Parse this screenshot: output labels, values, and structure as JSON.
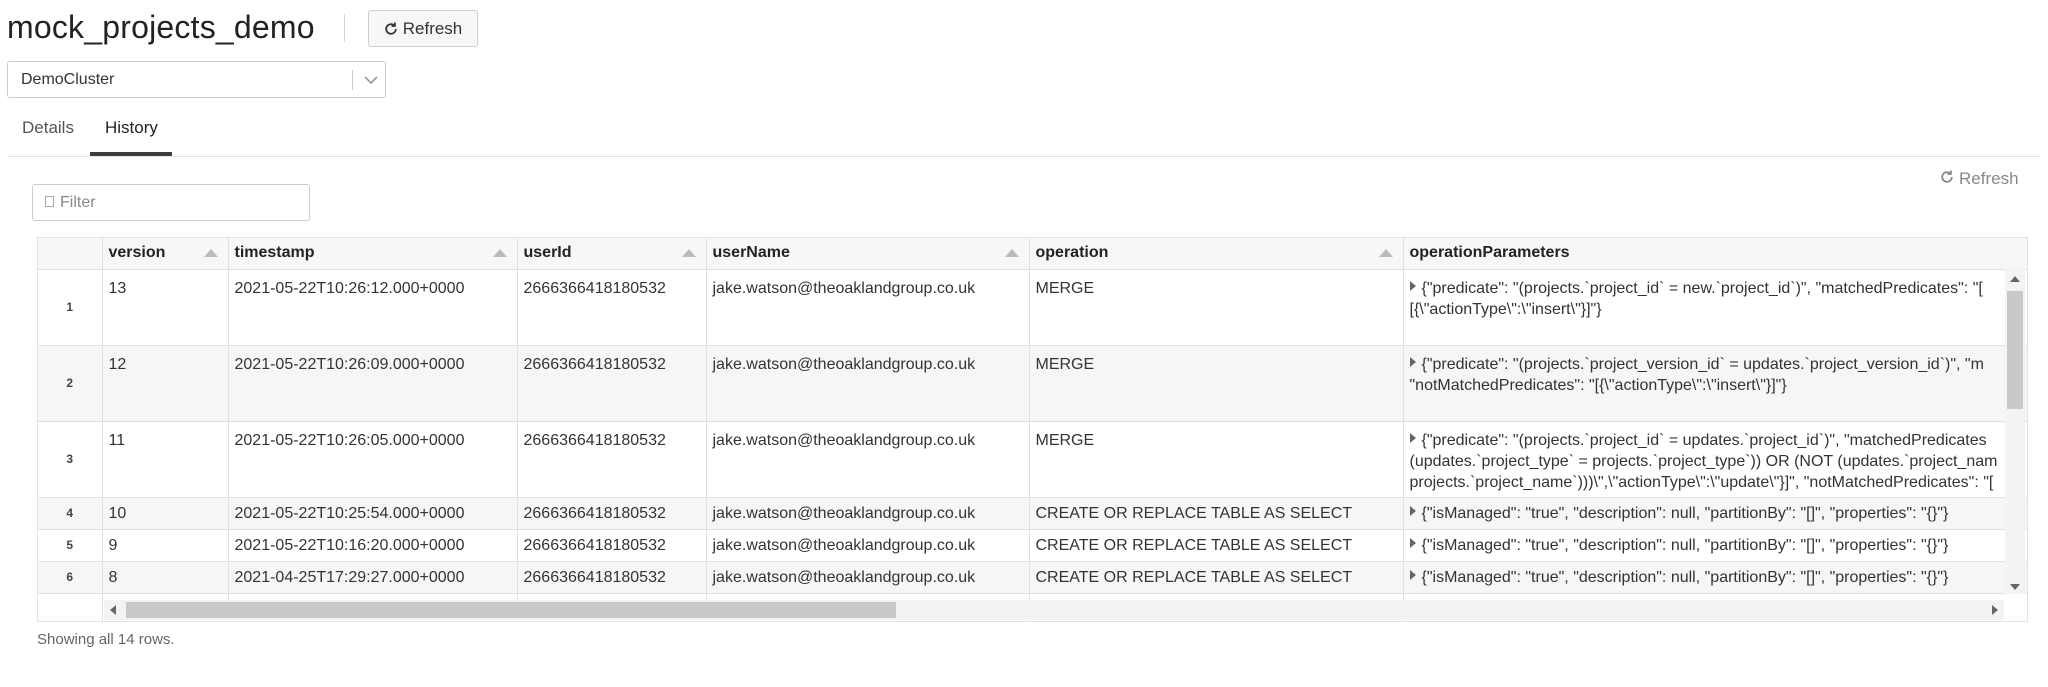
{
  "header": {
    "title": "mock_projects_demo",
    "refresh_label": "Refresh"
  },
  "cluster": {
    "selected": "DemoCluster"
  },
  "tabs": [
    {
      "label": "Details",
      "active": false
    },
    {
      "label": "History",
      "active": true
    }
  ],
  "history": {
    "refresh_label": "Refresh",
    "filter_placeholder": "Filter",
    "columns": [
      "version",
      "timestamp",
      "userId",
      "userName",
      "operation",
      "operationParameters"
    ],
    "rows": [
      {
        "index": "1",
        "version": "13",
        "timestamp": "2021-05-22T10:26:12.000+0000",
        "userId": "2666366418180532",
        "userName": "jake.watson@theoaklandgroup.co.uk",
        "operation": "MERGE",
        "params_line1": "{\"predicate\": \"(projects.`project_id` = new.`project_id`)\", \"matchedPredicates\": \"[",
        "params_line2": "[{\\\"actionType\\\":\\\"insert\\\"}]\"}"
      },
      {
        "index": "2",
        "version": "12",
        "timestamp": "2021-05-22T10:26:09.000+0000",
        "userId": "2666366418180532",
        "userName": "jake.watson@theoaklandgroup.co.uk",
        "operation": "MERGE",
        "params_line1": "{\"predicate\": \"(projects.`project_version_id` = updates.`project_version_id`)\", \"m",
        "params_line2": "\"notMatchedPredicates\": \"[{\\\"actionType\\\":\\\"insert\\\"}]\"}"
      },
      {
        "index": "3",
        "version": "11",
        "timestamp": "2021-05-22T10:26:05.000+0000",
        "userId": "2666366418180532",
        "userName": "jake.watson@theoaklandgroup.co.uk",
        "operation": "MERGE",
        "params_line1": "{\"predicate\": \"(projects.`project_id` = updates.`project_id`)\", \"matchedPredicates",
        "params_line2": "(updates.`project_type` = projects.`project_type`)) OR (NOT (updates.`project_nam",
        "params_line3": "projects.`project_name`)))\\\",\\\"actionType\\\":\\\"update\\\"}]\", \"notMatchedPredicates\": \"["
      },
      {
        "index": "4",
        "version": "10",
        "timestamp": "2021-05-22T10:25:54.000+0000",
        "userId": "2666366418180532",
        "userName": "jake.watson@theoaklandgroup.co.uk",
        "operation": "CREATE OR REPLACE TABLE AS SELECT",
        "params_line1": "{\"isManaged\": \"true\", \"description\": null, \"partitionBy\": \"[]\", \"properties\": \"{}\"}"
      },
      {
        "index": "5",
        "version": "9",
        "timestamp": "2021-05-22T10:16:20.000+0000",
        "userId": "2666366418180532",
        "userName": "jake.watson@theoaklandgroup.co.uk",
        "operation": "CREATE OR REPLACE TABLE AS SELECT",
        "params_line1": "{\"isManaged\": \"true\", \"description\": null, \"partitionBy\": \"[]\", \"properties\": \"{}\"}"
      },
      {
        "index": "6",
        "version": "8",
        "timestamp": "2021-04-25T17:29:27.000+0000",
        "userId": "2666366418180532",
        "userName": "jake.watson@theoaklandgroup.co.uk",
        "operation": "CREATE OR REPLACE TABLE AS SELECT",
        "params_line1": "{\"isManaged\": \"true\", \"description\": null, \"partitionBy\": \"[]\", \"properties\": \"{}\"}"
      }
    ],
    "status": "Showing all 14 rows."
  }
}
